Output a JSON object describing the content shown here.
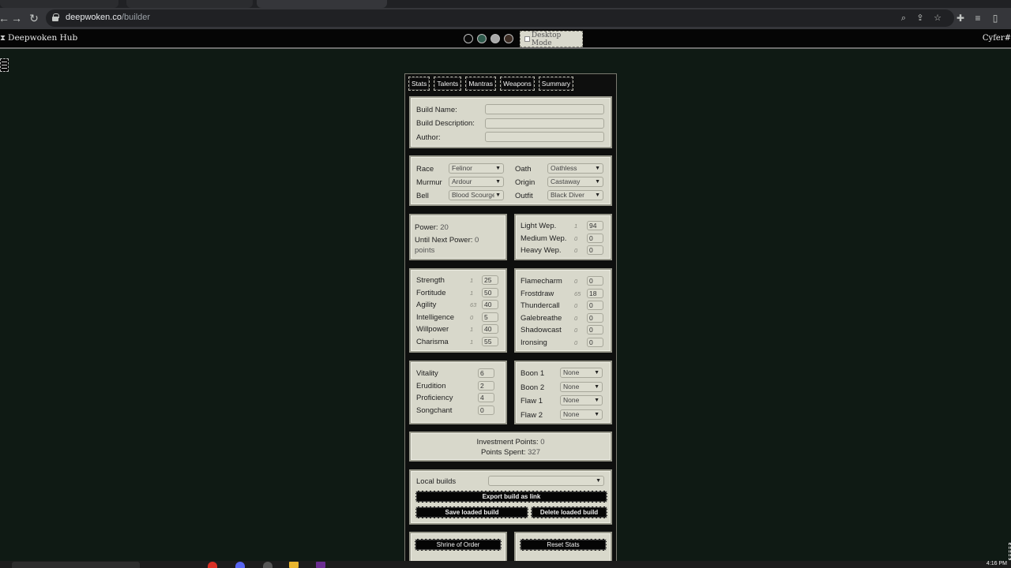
{
  "browser": {
    "url_domain": "deepwoken.co",
    "url_path": "/builder",
    "nav": {
      "back": "←",
      "forward": "→",
      "reload": "↻"
    }
  },
  "site": {
    "brand": "Deepwoken Hub",
    "theme_colors": [
      "#0a0a0a",
      "#2f5a4c",
      "#a9a9a9",
      "#3c2c24"
    ],
    "desktop_mode_label": "Desktop Mode",
    "user": "Cyfer#"
  },
  "tabs": [
    "Stats",
    "Talents",
    "Mantras",
    "Weapons",
    "Summary"
  ],
  "build_info": {
    "name_label": "Build Name:",
    "name_value": "",
    "description_label": "Build Description:",
    "description_value": "",
    "author_label": "Author:",
    "author_value": ""
  },
  "character": {
    "race_label": "Race",
    "race": "Felinor",
    "oath_label": "Oath",
    "oath": "Oathless",
    "murmur_label": "Murmur",
    "murmur": "Ardour",
    "origin_label": "Origin",
    "origin": "Castaway",
    "bell_label": "Bell",
    "bell": "Blood Scourge",
    "outfit_label": "Outfit",
    "outfit": "Black Diver"
  },
  "power": {
    "power_label": "Power:",
    "power_value": "20",
    "until_label": "Until Next Power:",
    "until_value": "0",
    "until_unit": "points"
  },
  "weapons": [
    {
      "name": "Light Wep.",
      "base": "1",
      "value": "94"
    },
    {
      "name": "Medium Wep.",
      "base": "0",
      "value": "0"
    },
    {
      "name": "Heavy Wep.",
      "base": "0",
      "value": "0"
    }
  ],
  "attributes": [
    {
      "name": "Strength",
      "base": "1",
      "value": "25"
    },
    {
      "name": "Fortitude",
      "base": "1",
      "value": "50"
    },
    {
      "name": "Agility",
      "base": "63",
      "value": "40"
    },
    {
      "name": "Intelligence",
      "base": "0",
      "value": "5"
    },
    {
      "name": "Willpower",
      "base": "1",
      "value": "40"
    },
    {
      "name": "Charisma",
      "base": "1",
      "value": "55"
    }
  ],
  "attunements": [
    {
      "name": "Flamecharm",
      "base": "0",
      "value": "0"
    },
    {
      "name": "Frostdraw",
      "base": "65",
      "value": "18"
    },
    {
      "name": "Thundercall",
      "base": "0",
      "value": "0"
    },
    {
      "name": "Galebreathe",
      "base": "0",
      "value": "0"
    },
    {
      "name": "Shadowcast",
      "base": "0",
      "value": "0"
    },
    {
      "name": "Ironsing",
      "base": "0",
      "value": "0"
    }
  ],
  "investments": [
    {
      "name": "Vitality",
      "value": "6"
    },
    {
      "name": "Erudition",
      "value": "2"
    },
    {
      "name": "Proficiency",
      "value": "4"
    },
    {
      "name": "Songchant",
      "value": "0"
    }
  ],
  "boons_flaws": [
    {
      "name": "Boon 1",
      "value": "None"
    },
    {
      "name": "Boon 2",
      "value": "None"
    },
    {
      "name": "Flaw 1",
      "value": "None"
    },
    {
      "name": "Flaw 2",
      "value": "None"
    }
  ],
  "summary": {
    "investment_label": "Investment Points:",
    "investment_value": "0",
    "spent_label": "Points Spent:",
    "spent_value": "327"
  },
  "local_builds": {
    "label": "Local builds",
    "selected": "",
    "export_label": "Export build as link",
    "save_label": "Save loaded build",
    "delete_label": "Delete loaded build"
  },
  "footer_buttons": {
    "shrine_label": "Shrine of Order",
    "reset_label": "Reset Stats"
  },
  "taskbar": {
    "time": "4:16 PM"
  }
}
